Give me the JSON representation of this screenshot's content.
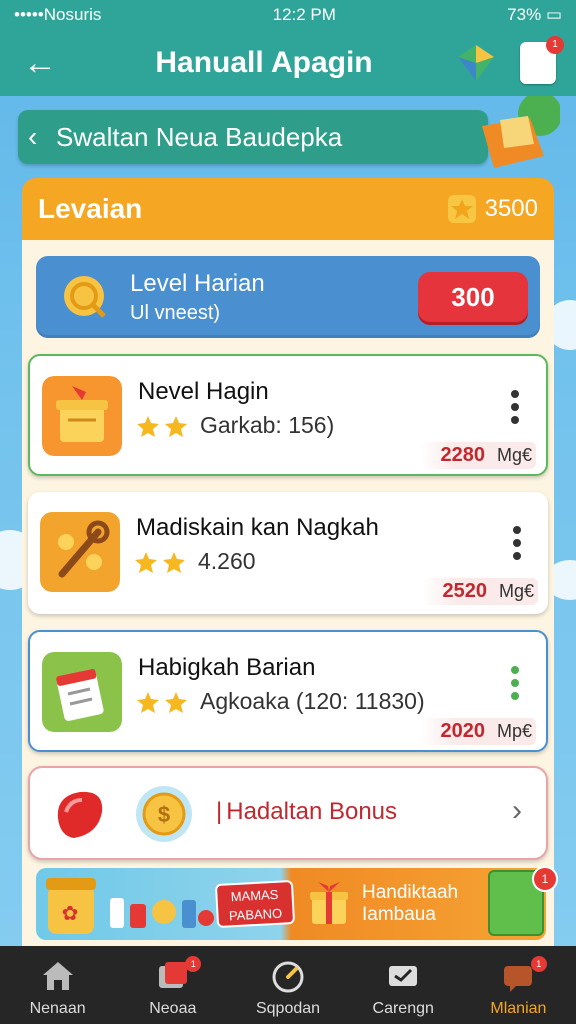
{
  "status_bar": {
    "carrier": "•••••Nosuris",
    "time": "12:2 PM",
    "battery": "73%"
  },
  "header": {
    "title": "Hanuall Apagin",
    "notification_badge": "1"
  },
  "sub_banner": {
    "text": "Swaltan Neua Baudepka"
  },
  "panel": {
    "title": "Levaian",
    "coins": "3500"
  },
  "level_card": {
    "title": "Level Harian",
    "subtitle": "Ul vneest)",
    "button": "300"
  },
  "quests": [
    {
      "title": "Nevel Hagin",
      "subtitle": "Garkab: 156)",
      "reward": "2280",
      "unit": "Mg€",
      "icon": "gift-box-icon",
      "icon_bg": "#f7962e"
    },
    {
      "title": "Madiskain kan Nagkah",
      "subtitle": "4.260",
      "reward": "2520",
      "unit": "Mg€",
      "icon": "wrench-icon",
      "icon_bg": "#f3a42c"
    },
    {
      "title": "Habigkah Barian",
      "subtitle": "Agkoaka (120: 11830)",
      "reward": "2020",
      "unit": "Mp€",
      "icon": "calendar-icon",
      "icon_bg": "#8bc34a"
    }
  ],
  "bonus": {
    "label": "Hadaltan Bonus"
  },
  "promo": {
    "tag": "MAMAS PABANO",
    "text_line1": "Handiktaah",
    "text_line2": "Iambaua",
    "badge": "1"
  },
  "nav": [
    {
      "label": "Nenaan",
      "icon": "home-icon"
    },
    {
      "label": "Neoaa",
      "icon": "cards-icon",
      "badge": "1"
    },
    {
      "label": "Sqpodan",
      "icon": "timer-icon"
    },
    {
      "label": "Carengn",
      "icon": "ticket-icon"
    },
    {
      "label": "Mlanian",
      "icon": "chat-icon",
      "badge": "1"
    }
  ],
  "colors": {
    "header": "#2fa59a",
    "accent_orange": "#f5a623",
    "reward_red": "#c0282e",
    "level_blue": "#4a8fd0"
  }
}
